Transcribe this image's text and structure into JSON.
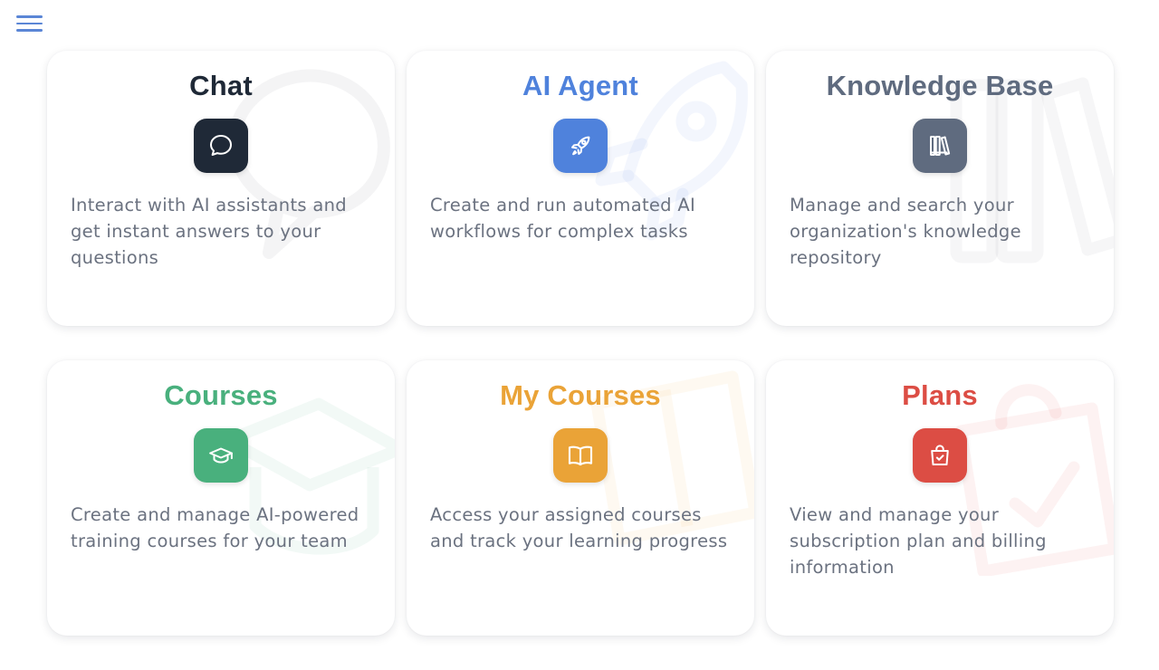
{
  "header": {
    "menu_icon": "hamburger-menu-icon",
    "accent": "#5b86d6"
  },
  "cards": [
    {
      "title": "Chat",
      "color": "#1f2937",
      "icon": "chat-bubble-icon",
      "description": "Interact with AI assistants and get instant answers to your questions"
    },
    {
      "title": "AI Agent",
      "color": "#4f82dc",
      "icon": "rocket-icon",
      "description": "Create and run automated AI workflows for complex tasks"
    },
    {
      "title": "Knowledge Base",
      "color": "#5f6b7f",
      "icon": "library-books-icon",
      "description": "Manage and search your organization's knowledge repository"
    },
    {
      "title": "Courses",
      "color": "#49b07d",
      "icon": "graduation-cap-icon",
      "description": "Create and manage AI-powered training courses for your team"
    },
    {
      "title": "My Courses",
      "color": "#eaa337",
      "icon": "open-book-icon",
      "description": "Access your assigned courses and track your learning progress"
    },
    {
      "title": "Plans",
      "color": "#dc4d44",
      "icon": "shopping-bag-check-icon",
      "description": "View and manage your subscription plan and billing information"
    }
  ]
}
